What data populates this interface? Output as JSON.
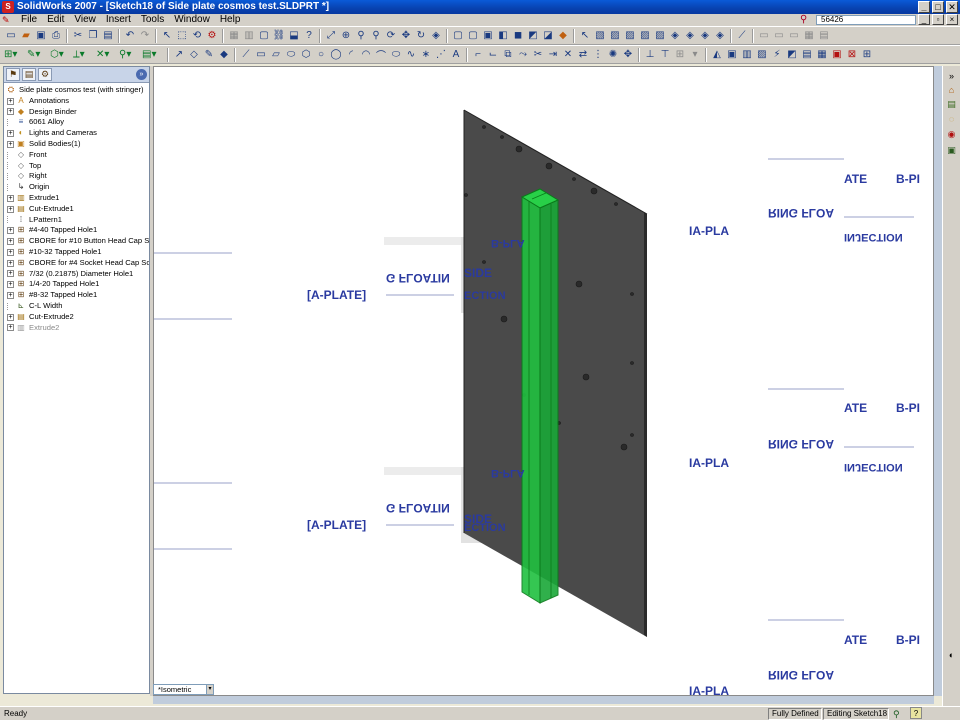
{
  "window": {
    "title": "SolidWorks 2007 - [Sketch18 of Side plate cosmos test.SLDPRT *]",
    "min_glyph": "_",
    "max_glyph": "□",
    "close_glyph": "✕"
  },
  "menu": {
    "items": [
      "File",
      "Edit",
      "View",
      "Insert",
      "Tools",
      "Window",
      "Help"
    ],
    "search_value": "56426"
  },
  "feature_tree": {
    "root": "Side plate cosmos test  (with stringer)",
    "items": [
      {
        "label": "Annotations",
        "icon": "annotations-icon",
        "expandable": true,
        "suppressed": false
      },
      {
        "label": "Design Binder",
        "icon": "design-binder-icon",
        "expandable": true,
        "suppressed": false
      },
      {
        "label": "6061 Alloy",
        "icon": "material-icon",
        "expandable": false,
        "suppressed": false
      },
      {
        "label": "Lights and Cameras",
        "icon": "lights-icon",
        "expandable": true,
        "suppressed": false
      },
      {
        "label": "Solid Bodies(1)",
        "icon": "solid-bodies-icon",
        "expandable": true,
        "suppressed": false
      },
      {
        "label": "Front",
        "icon": "plane-icon",
        "expandable": false,
        "suppressed": false
      },
      {
        "label": "Top",
        "icon": "plane-icon",
        "expandable": false,
        "suppressed": false
      },
      {
        "label": "Right",
        "icon": "plane-icon",
        "expandable": false,
        "suppressed": false
      },
      {
        "label": "Origin",
        "icon": "origin-icon",
        "expandable": false,
        "suppressed": false
      },
      {
        "label": "Extrude1",
        "icon": "extrude-icon",
        "expandable": true,
        "suppressed": false
      },
      {
        "label": "Cut-Extrude1",
        "icon": "cut-extrude-icon",
        "expandable": true,
        "suppressed": false
      },
      {
        "label": "LPattern1",
        "icon": "pattern-icon",
        "expandable": false,
        "suppressed": false
      },
      {
        "label": "#4-40 Tapped Hole1",
        "icon": "hole-icon",
        "expandable": true,
        "suppressed": false
      },
      {
        "label": "CBORE for #10 Button Head Cap S",
        "icon": "hole-icon",
        "expandable": true,
        "suppressed": false
      },
      {
        "label": "#10-32 Tapped Hole1",
        "icon": "hole-icon",
        "expandable": true,
        "suppressed": false
      },
      {
        "label": "CBORE for #4 Socket Head Cap Sc",
        "icon": "hole-icon",
        "expandable": true,
        "suppressed": false
      },
      {
        "label": "7/32 (0.21875) Diameter Hole1",
        "icon": "hole-icon",
        "expandable": true,
        "suppressed": false
      },
      {
        "label": "1/4-20 Tapped Hole1",
        "icon": "hole-icon",
        "expandable": true,
        "suppressed": false
      },
      {
        "label": "#8-32 Tapped Hole1",
        "icon": "hole-icon",
        "expandable": true,
        "suppressed": false
      },
      {
        "label": "C-L Width",
        "icon": "dimension-icon",
        "expandable": false,
        "suppressed": false
      },
      {
        "label": "Cut-Extrude2",
        "icon": "cut-extrude-icon",
        "expandable": true,
        "suppressed": false
      },
      {
        "label": "Extrude2",
        "icon": "extrude-icon",
        "expandable": true,
        "suppressed": true
      }
    ]
  },
  "viewport": {
    "view_orientation": "*Isometric",
    "decal_labels": {
      "side": "SIDE",
      "section": "ECTION",
      "floating": "G FLOATIN",
      "bplate": "B-PLA",
      "aplate": "[A-PLATE]",
      "ring_float": "RING FLOA",
      "ate": "ATE",
      "bpl": "B-PI",
      "ia_pla": "IA-PLA",
      "injection": "INJECTION"
    },
    "colors": {
      "plate": "#4a4a4a",
      "stringer": "#22c03a",
      "decal_text": "#2a3aa0"
    }
  },
  "status": {
    "ready": "Ready",
    "fully_defined": "Fully Defined",
    "editing": "Editing Sketch18"
  }
}
